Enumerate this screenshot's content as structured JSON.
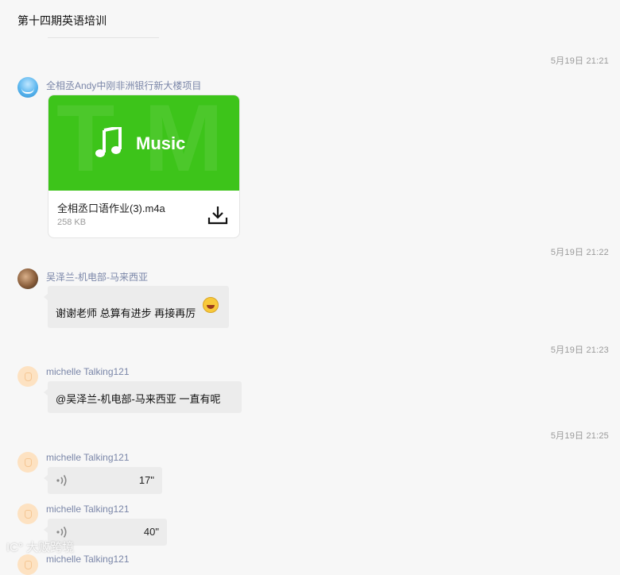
{
  "header": {
    "title": "第十四期英语培训"
  },
  "messages": [
    {
      "time": "5月19日  21:21",
      "sender": "全相丞Andy中刚非洲银行新大楼项目",
      "file": {
        "banner_label": "Music",
        "name": "全相丞口语作业(3).m4a",
        "size": "258 KB"
      }
    },
    {
      "time": "5月19日  21:22",
      "sender": "吴泽兰-机电部-马来西亚",
      "text": "谢谢老师  总算有进步  再接再厉"
    },
    {
      "time": "5月19日  21:23",
      "sender": "michelle Talking121",
      "text": "@吴泽兰-机电部-马来西亚 一直有呢"
    },
    {
      "time": "5月19日  21:25",
      "sender": "michelle Talking121",
      "voice_duration": "17\""
    },
    {
      "sender": "michelle Talking121",
      "voice_duration": "40\""
    },
    {
      "sender": "michelle Talking121"
    }
  ],
  "watermark": "大败跨境",
  "icons": [
    "music-note-icon",
    "download-icon",
    "voice-wave-icon",
    "laughing-emoji-icon"
  ],
  "colors": {
    "accent_green": "#3dc41a",
    "sender_name": "#7a86a8",
    "bubble": "#ececec"
  }
}
